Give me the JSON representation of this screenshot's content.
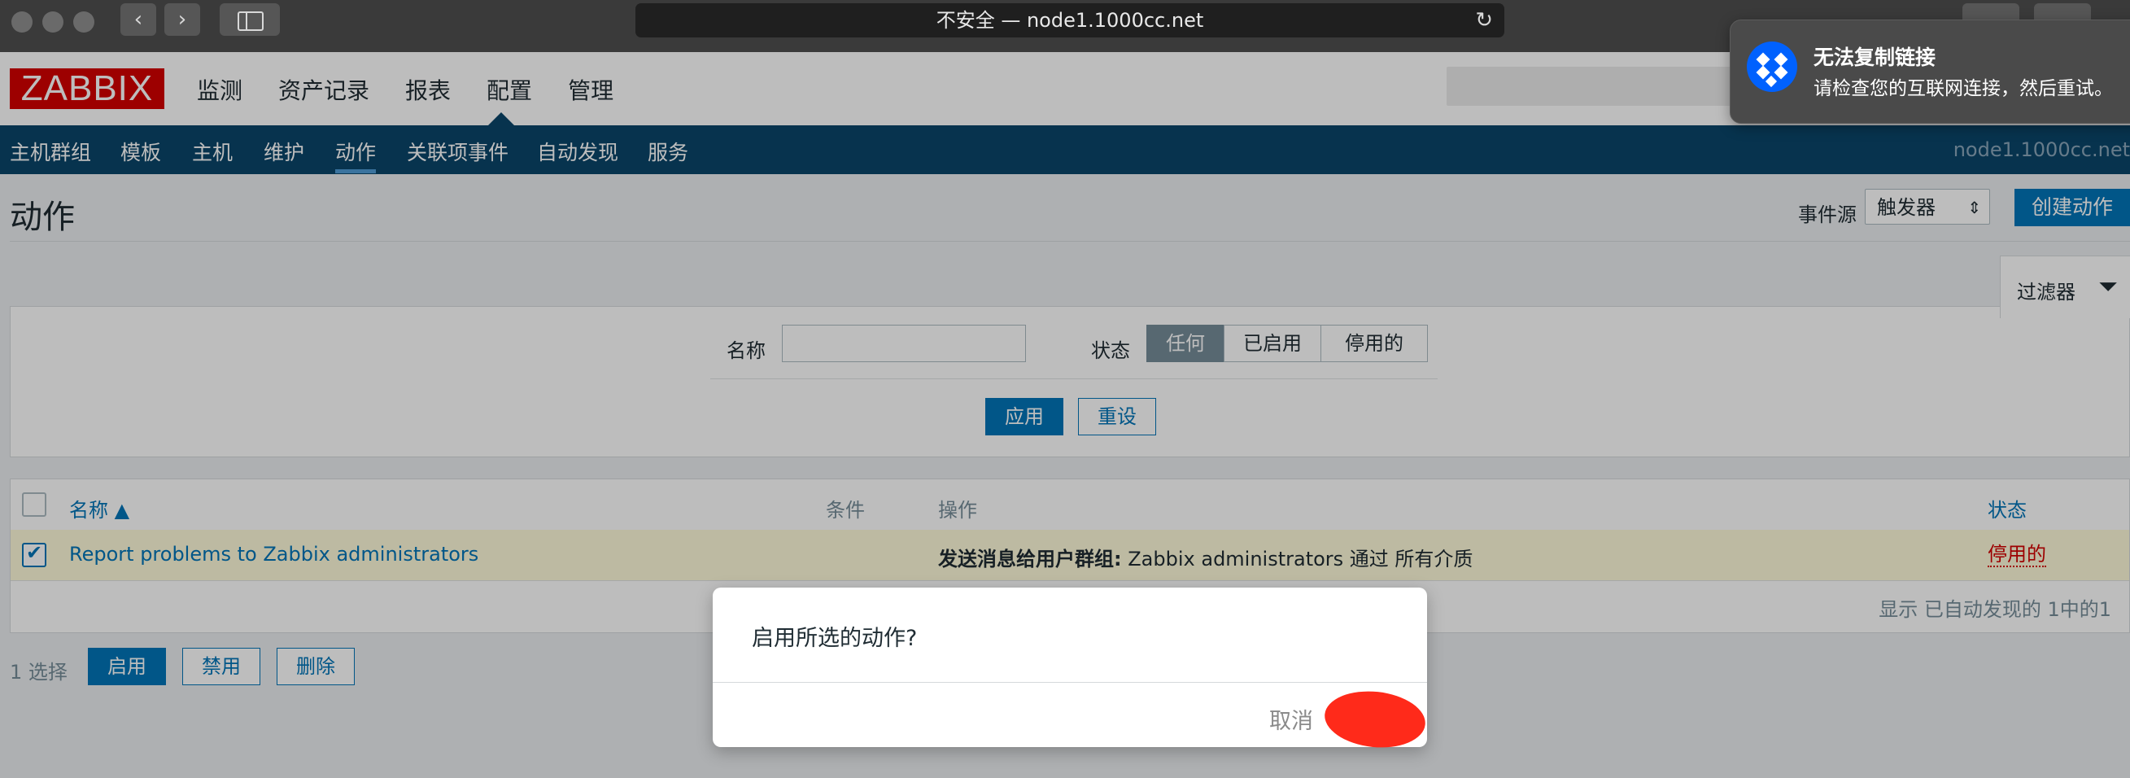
{
  "browser": {
    "url_display": "不安全 — node1.1000cc.net"
  },
  "header": {
    "logo": "ZABBIX",
    "main_menu": [
      "监测",
      "资产记录",
      "报表",
      "配置",
      "管理"
    ],
    "sub_menu": [
      "主机群组",
      "模板",
      "主机",
      "维护",
      "动作",
      "关联项事件",
      "自动发现",
      "服务"
    ],
    "server_name": "node1.1000cc.net"
  },
  "page": {
    "title": "动作",
    "event_source_label": "事件源",
    "event_source_value": "触发器",
    "create_button": "创建动作"
  },
  "filter": {
    "tab_label": "过滤器",
    "name_label": "名称",
    "name_value": "",
    "status_label": "状态",
    "status_options": [
      "任何",
      "已启用",
      "停用的"
    ],
    "status_selected": "任何",
    "apply_button": "应用",
    "reset_button": "重设"
  },
  "table": {
    "columns": [
      "名称 ▲",
      "条件",
      "操作",
      "状态"
    ],
    "rows": [
      {
        "checked": true,
        "name": "Report problems to Zabbix administrators",
        "conditions": "",
        "operation_bold": "发送消息给用户群组:",
        "operation_rest": " Zabbix administrators 通过 所有介质",
        "status": "停用的"
      }
    ],
    "footer": "显示 已自动发现的 1中的1"
  },
  "bulk": {
    "selected_count": "1 选择",
    "enable_button": "启用",
    "disable_button": "禁用",
    "delete_button": "删除"
  },
  "dialog": {
    "message": "启用所选的动作?",
    "cancel_button": "取消"
  },
  "notification": {
    "title": "无法复制链接",
    "body": "请检查您的互联网连接，然后重试。"
  },
  "colors": {
    "zabbix_red": "#d40000",
    "nav_blue": "#0a466a",
    "primary_blue": "#0275b8",
    "dropbox_blue": "#0061fe"
  }
}
